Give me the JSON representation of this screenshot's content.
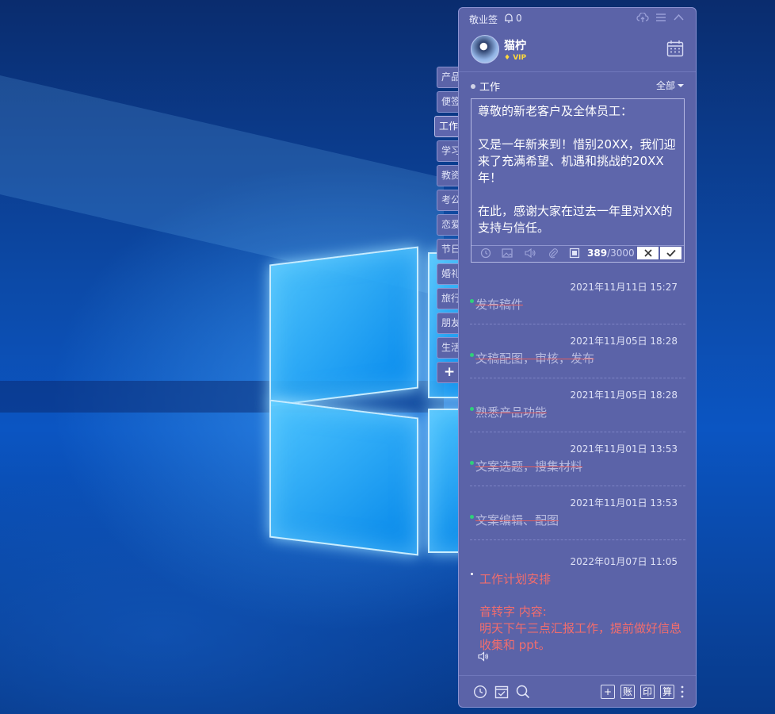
{
  "app": {
    "title": "敬业签",
    "bell_count": "0",
    "user": {
      "name": "猫柠",
      "vip": "VIP"
    },
    "category": {
      "current": "工作",
      "filter": "全部"
    },
    "side_tabs": [
      "产品",
      "便签",
      "工作",
      "学习",
      "教资",
      "考公",
      "恋爱",
      "节日",
      "婚礼",
      "旅行",
      "朋友",
      "生活",
      "+"
    ],
    "editor": {
      "text": "尊敬的新老客户及全体员工：\n\n又是一年新来到！惜别20XX，我们迎来了充满希望、机遇和挑战的20XX年！\n\n在此，感谢大家在过去一年里对XX的支持与信任。",
      "count": "389",
      "max": "/3000"
    },
    "notes": [
      {
        "date": "2021年11月11日 15:27",
        "title": "发布稿件"
      },
      {
        "date": "2021年11月05日 18:28",
        "title": "文稿配图，审核，发布"
      },
      {
        "date": "2021年11月05日 18:28",
        "title": "熟悉产品功能"
      },
      {
        "date": "2021年11月01日 13:53",
        "title": "文案选题，搜集材料"
      },
      {
        "date": "2021年11月01日 13:53",
        "title": "文案编辑、配图"
      }
    ],
    "last_note": {
      "date": "2022年01月07日 11:05",
      "title": "工作计划安排",
      "body": "音转字 内容:\n明天下午三点汇报工作，提前做好信息收集和 ppt。"
    },
    "bottom_boxes": [
      "+",
      "账",
      "印",
      "算"
    ],
    "colors": {
      "window_bg": "#5b63a8",
      "done_strike": "#e35d5d",
      "done_dot": "#2fd07a",
      "reminder_text": "#f26d6d"
    }
  }
}
